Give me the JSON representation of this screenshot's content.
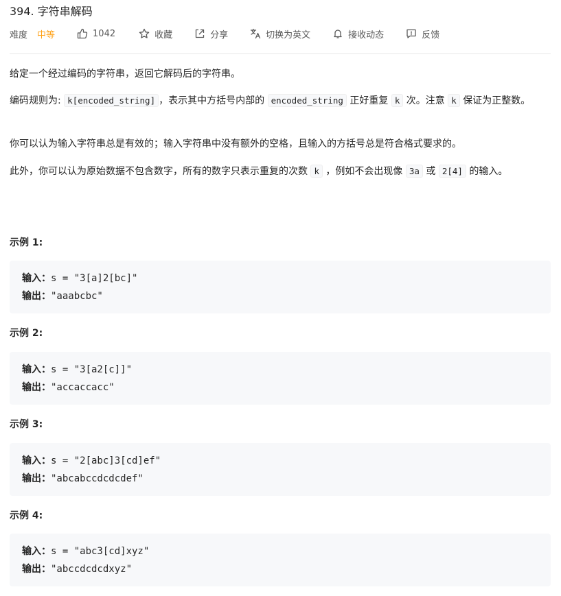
{
  "problem": {
    "title": "394. 字符串解码",
    "difficulty_label": "难度",
    "difficulty": "中等",
    "likes": "1042",
    "favorite_label": "收藏",
    "share_label": "分享",
    "translate_label": "切换为英文",
    "subscribe_label": "接收动态",
    "feedback_label": "反馈"
  },
  "colors": {
    "difficulty_medium": "#ffa116",
    "code_bg": "#f7f8fa"
  },
  "description": {
    "p1": "给定一个经过编码的字符串，返回它解码后的字符串。",
    "p2_a": "编码规则为: ",
    "p2_code1": "k[encoded_string]",
    "p2_b": "，表示其中方括号内部的 ",
    "p2_code2": "encoded_string",
    "p2_c": " 正好重复 ",
    "p2_code3": "k",
    "p2_d": " 次。注意 ",
    "p2_code4": "k",
    "p2_e": " 保证为正整数。",
    "p3": "你可以认为输入字符串总是有效的；输入字符串中没有额外的空格，且输入的方括号总是符合格式要求的。",
    "p4_a": "此外，你可以认为原始数据不包含数字，所有的数字只表示重复的次数 ",
    "p4_code1": "k",
    "p4_b": " ，例如不会出现像 ",
    "p4_code2": "3a",
    "p4_c": " 或 ",
    "p4_code3": "2[4]",
    "p4_d": " 的输入。"
  },
  "examples": [
    {
      "title": "示例 1:",
      "input_label": "输入：",
      "input": "s = \"3[a]2[bc]\"",
      "output_label": "输出：",
      "output": "\"aaabcbc\""
    },
    {
      "title": "示例 2:",
      "input_label": "输入：",
      "input": "s = \"3[a2[c]]\"",
      "output_label": "输出：",
      "output": "\"accaccacc\""
    },
    {
      "title": "示例 3:",
      "input_label": "输入：",
      "input": "s = \"2[abc]3[cd]ef\"",
      "output_label": "输出：",
      "output": "\"abcabccdcdcdef\""
    },
    {
      "title": "示例 4:",
      "input_label": "输入：",
      "input": "s = \"abc3[cd]xyz\"",
      "output_label": "输出：",
      "output": "\"abccdcdcdxyz\""
    }
  ]
}
